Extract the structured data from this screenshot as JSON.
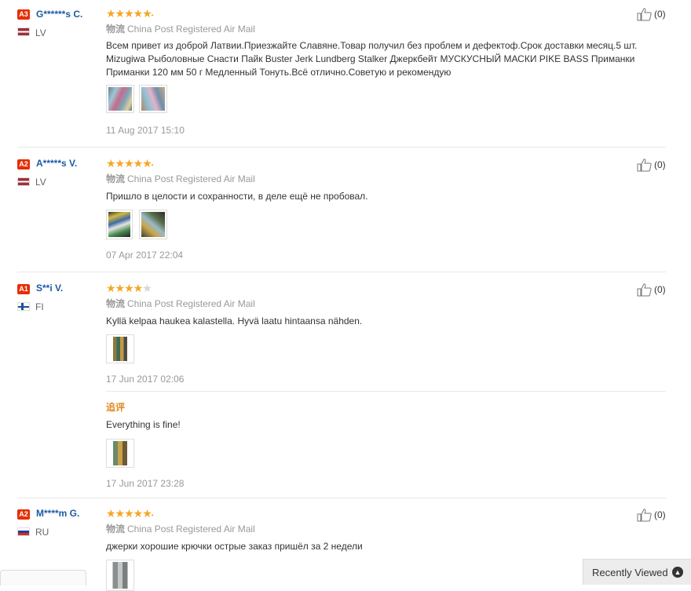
{
  "reviews": [
    {
      "level": "A3",
      "name": "G******s C.",
      "country": "LV",
      "rating": 5,
      "logistics_label": "物流",
      "logistics": "China Post Registered Air Mail",
      "text": "Всем привет из доброй Латвии.Приезжайте Славяне.Товар получил без проблем и дефектоф.Срок доставки месяц.5 шт. Mizugiwa Рыболовные Снасти Пайк Buster Jerk Lundberg Stalker Джеркбейт МУСКУСНЫЙ МАСКИ PIKE BASS Приманки Приманки 120 мм 50 г Медленный Тонуть.Всё отлично.Советую и рекомендую",
      "date": "11 Aug 2017 15:10",
      "likes": "(0)"
    },
    {
      "level": "A2",
      "name": "A*****s V.",
      "country": "LV",
      "rating": 5,
      "logistics_label": "物流",
      "logistics": "China Post Registered Air Mail",
      "text": "Пришло в целости и сохранности, в деле ещё не пробовал.",
      "date": "07 Apr 2017 22:04",
      "likes": "(0)"
    },
    {
      "level": "A1",
      "name": "S**i V.",
      "country": "FI",
      "rating": 4,
      "logistics_label": "物流",
      "logistics": "China Post Registered Air Mail",
      "text": "Kyllä kelpaa haukea kalastella. Hyvä laatu hintaansa nähden.",
      "date": "17 Jun 2017 02:06",
      "likes": "(0)",
      "additional": {
        "label": "追评",
        "text": "Everything is fine!",
        "date": "17 Jun 2017 23:28"
      }
    },
    {
      "level": "A2",
      "name": "M****m G.",
      "country": "RU",
      "rating": 5,
      "logistics_label": "物流",
      "logistics": "China Post Registered Air Mail",
      "text": "джерки хорошие крючки острые заказ пришёл за 2 недели",
      "likes": "(0)"
    }
  ],
  "recently_viewed": {
    "label": "Recently Viewed",
    "icon": "chevron-up-icon"
  },
  "colors": {
    "star": "#f5a623",
    "username": "#1a5aa5",
    "level_badge": "#e62e04",
    "additional_label": "#e08a1f"
  }
}
